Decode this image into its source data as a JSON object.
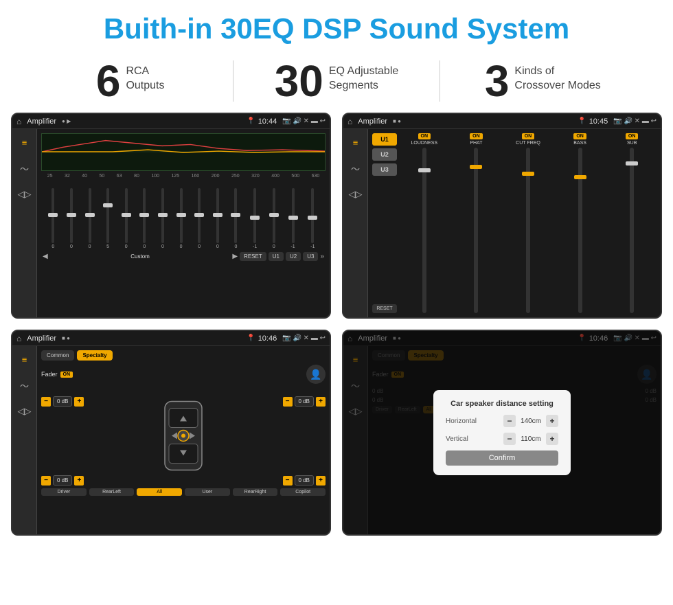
{
  "page": {
    "title": "Buith-in 30EQ DSP Sound System"
  },
  "stats": [
    {
      "number": "6",
      "line1": "RCA",
      "line2": "Outputs"
    },
    {
      "number": "30",
      "line1": "EQ Adjustable",
      "line2": "Segments"
    },
    {
      "number": "3",
      "line1": "Kinds of",
      "line2": "Crossover Modes"
    }
  ],
  "screens": {
    "screen1": {
      "title": "Amplifier",
      "time": "10:44",
      "freqs": [
        "25",
        "32",
        "40",
        "50",
        "63",
        "80",
        "100",
        "125",
        "160",
        "200",
        "250",
        "320",
        "400",
        "500",
        "630"
      ],
      "vals": [
        "0",
        "0",
        "0",
        "5",
        "0",
        "0",
        "0",
        "0",
        "0",
        "0",
        "0",
        "-1",
        "0",
        "-1"
      ],
      "buttons": [
        "RESET",
        "U1",
        "U2",
        "U3"
      ],
      "preset": "Custom"
    },
    "screen2": {
      "title": "Amplifier",
      "time": "10:45",
      "channels": [
        "LOUDNESS",
        "PHAT",
        "CUT FREQ",
        "BASS",
        "SUB"
      ]
    },
    "screen3": {
      "title": "Amplifier",
      "time": "10:46",
      "tabs": [
        "Common",
        "Specialty"
      ],
      "activeTab": "Specialty",
      "faderLabel": "Fader",
      "faderOn": "ON",
      "controls": {
        "topLeft": "0 dB",
        "topRight": "0 dB",
        "bottomLeft": "0 dB",
        "bottomRight": "0 dB"
      },
      "bottomBtns": [
        "Driver",
        "",
        "All",
        "",
        "User",
        "RearLeft",
        "",
        "RearRight",
        "Copilot"
      ]
    },
    "screen4": {
      "title": "Amplifier",
      "time": "10:46",
      "tabs": [
        "Common",
        "Specialty"
      ],
      "dialog": {
        "title": "Car speaker distance setting",
        "horizontal": "140cm",
        "vertical": "110cm",
        "confirmLabel": "Confirm"
      }
    }
  }
}
